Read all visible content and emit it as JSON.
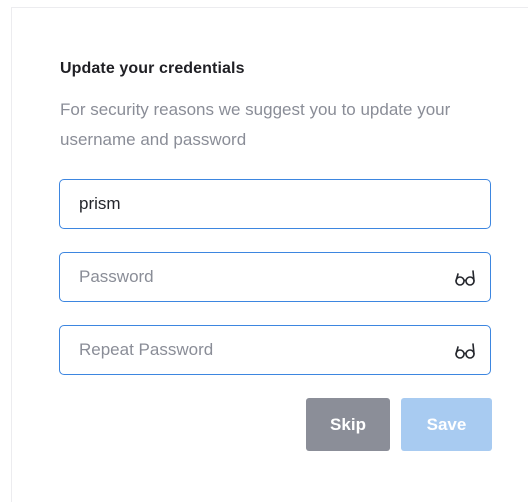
{
  "dialog": {
    "title": "Update your credentials",
    "description": "For security reasons we suggest you to update your username and password"
  },
  "form": {
    "username": {
      "value": "prism",
      "placeholder": ""
    },
    "password": {
      "value": "",
      "placeholder": "Password",
      "icon": "glasses-icon"
    },
    "repeat_password": {
      "value": "",
      "placeholder": "Repeat Password",
      "icon": "glasses-icon"
    }
  },
  "actions": {
    "skip_label": "Skip",
    "save_label": "Save",
    "skip_color": "#8b8e98",
    "save_color": "#a8cbf1",
    "save_disabled": true
  },
  "colors": {
    "field_border": "#3d86e0",
    "placeholder": "#8a8d97"
  }
}
